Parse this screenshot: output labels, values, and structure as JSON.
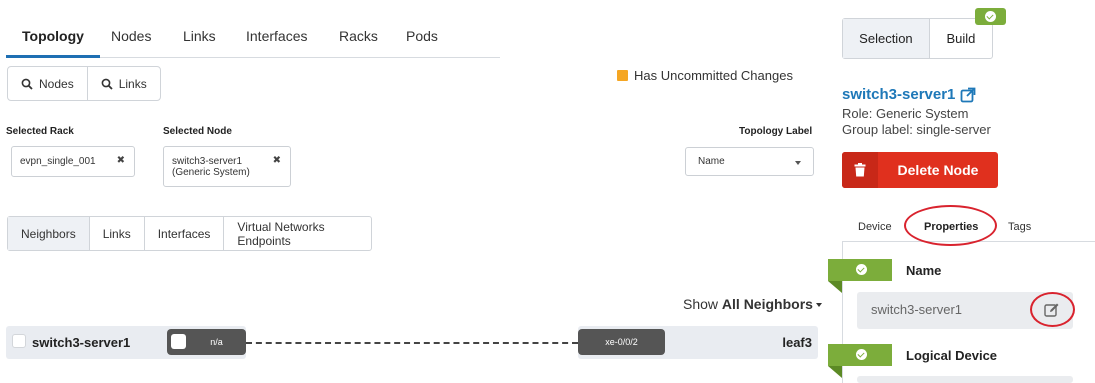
{
  "top_tabs": [
    "Topology",
    "Nodes",
    "Links",
    "Interfaces",
    "Racks",
    "Pods"
  ],
  "search_buttons": {
    "nodes": "Nodes",
    "links": "Links"
  },
  "status": {
    "uncommitted": "Has Uncommitted Changes",
    "color": "#f5a623"
  },
  "selected_rack": {
    "label": "Selected Rack",
    "value": "evpn_single_001"
  },
  "selected_node": {
    "label": "Selected Node",
    "line1": "switch3-server1",
    "line2": "(Generic System)"
  },
  "topology_label": {
    "label": "Topology Label",
    "value": "Name"
  },
  "sub_tabs": [
    "Neighbors",
    "Links",
    "Interfaces",
    "Virtual Networks Endpoints"
  ],
  "show_neighbors": {
    "prefix": "Show",
    "value": "All Neighbors"
  },
  "topology": {
    "left_node": "switch3-server1",
    "left_port": "n/a",
    "right_port": "xe-0/0/2",
    "right_node": "leaf3"
  },
  "right_panel": {
    "segments": [
      "Selection",
      "Build"
    ],
    "node_name": "switch3-server1",
    "role": "Role: Generic System",
    "group_label": "Group label: single-server",
    "delete_button": "Delete Node",
    "prop_tabs": [
      "Device",
      "Properties",
      "Tags"
    ],
    "properties": {
      "name_label": "Name",
      "name_value": "switch3-server1",
      "logical_device_label": "Logical Device"
    }
  },
  "colors": {
    "accent": "#1e6fb3",
    "link": "#1e78b8",
    "danger": "#e0301e",
    "ok": "#7cad3b",
    "highlight": "#d9232e"
  }
}
